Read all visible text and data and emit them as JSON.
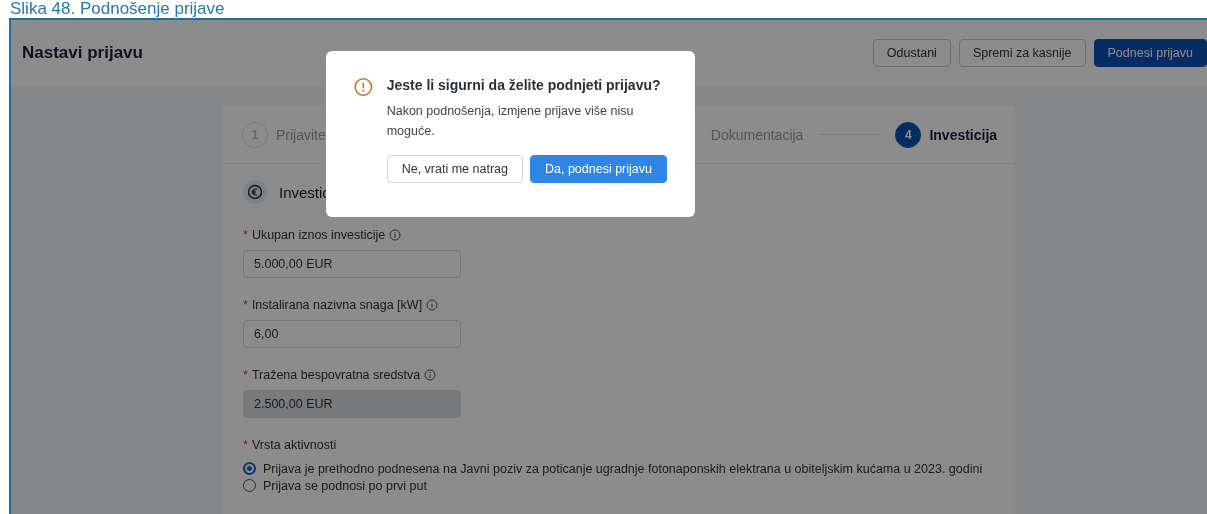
{
  "caption": "Slika 48. Podnošenje prijave",
  "header": {
    "title": "Nastavi prijavu",
    "buttons": [
      {
        "label": "Odustani",
        "kind": "outline"
      },
      {
        "label": "Spremi za kasnije",
        "kind": "outline"
      },
      {
        "label": "Podnesi prijavu",
        "kind": "primary"
      }
    ]
  },
  "steps": [
    {
      "number": "1",
      "label": "Prijavite",
      "selected": false
    },
    {
      "label": "Dokumentacija",
      "selected": false
    },
    {
      "number": "4",
      "label": "Investicija",
      "selected": true
    }
  ],
  "section": {
    "title": "Investic"
  },
  "fields": [
    {
      "required_mark": "*",
      "label": "Ukupan iznos investicije",
      "value": "5.000,00 EUR",
      "disabled": false
    },
    {
      "required_mark": "*",
      "label": "Instalirana nazivna snaga [kW]",
      "value": "6,00",
      "disabled": false
    },
    {
      "required_mark": "*",
      "label": "Tražena bespovratna sredstva",
      "value": "2.500,00 EUR",
      "disabled": true
    }
  ],
  "activity": {
    "required_mark": "*",
    "label": "Vrsta aktivnosti",
    "options": [
      {
        "label": "Prijava je prethodno podnesena na Javni poziv za poticanje ugradnje fotonaponskih elektrana u obiteljskim kućama u 2023. godini",
        "selected": true
      },
      {
        "label": "Prijava se podnosi po prvi put",
        "selected": false
      }
    ]
  },
  "dialog": {
    "title": "Jeste li sigurni da želite podnjeti prijavu?",
    "message": "Nakon podnošenja, izmjene prijave više nisu moguće.",
    "buttons": [
      {
        "label": "Ne, vrati me natrag",
        "kind": "outline"
      },
      {
        "label": "Da, podnesi prijavu",
        "kind": "primary"
      }
    ]
  }
}
